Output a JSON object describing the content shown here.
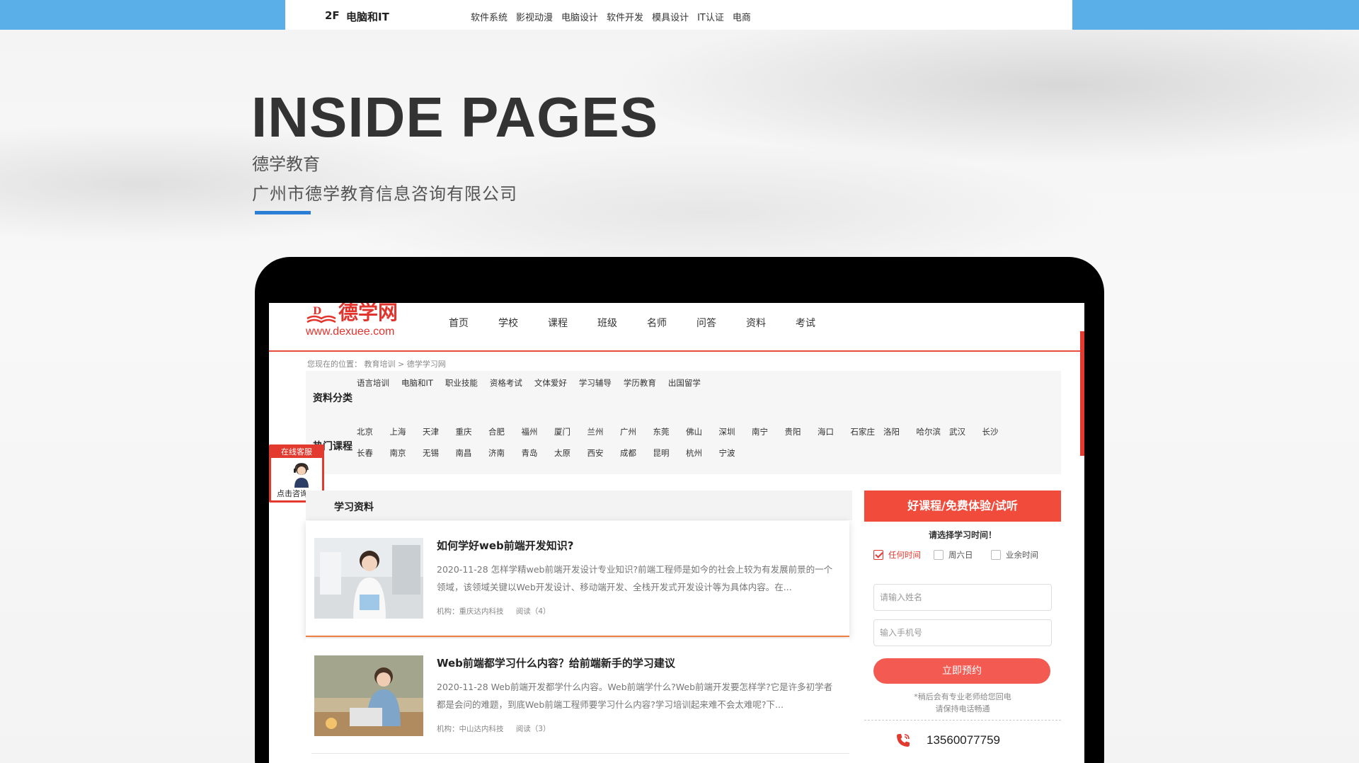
{
  "topbar": {
    "floor_number": "2F",
    "floor_title": "电脑和IT",
    "links": [
      "软件系统",
      "影视动漫",
      "电脑设计",
      "软件开发",
      "模具设计",
      "IT认证",
      "电商"
    ]
  },
  "hero": {
    "title": "INSIDE PAGES",
    "subtitle": "德学教育",
    "company": "广州市德学教育信息咨询有限公司"
  },
  "site": {
    "logo_text": "德学网",
    "logo_url": "www.dexuee.com",
    "nav": [
      "首页",
      "学校",
      "课程",
      "班级",
      "名师",
      "问答",
      "资料",
      "考试"
    ],
    "breadcrumb": "您现在的位置： 教育培训 > 德学学习网"
  },
  "categories": {
    "label": "资料分类",
    "items": [
      "语言培训",
      "电脑和IT",
      "职业技能",
      "资格考试",
      "文体爱好",
      "学习辅导",
      "学历教育",
      "出国留学"
    ]
  },
  "hot_courses": {
    "label": "热门课程",
    "cities_row1": [
      "北京",
      "上海",
      "天津",
      "重庆",
      "合肥",
      "福州",
      "厦门",
      "兰州",
      "广州",
      "东莞",
      "佛山",
      "深圳",
      "南宁",
      "贵阳",
      "海口",
      "石家庄",
      "洛阳",
      "哈尔滨",
      "武汉",
      "长沙"
    ],
    "cities_row2": [
      "长春",
      "南京",
      "无锡",
      "南昌",
      "济南",
      "青岛",
      "太原",
      "西安",
      "成都",
      "昆明",
      "杭州",
      "宁波"
    ]
  },
  "service": {
    "header": "在线客服",
    "button": "点击咨询"
  },
  "materials": {
    "heading": "学习资料",
    "articles": [
      {
        "title": "如何学好web前端开发知识?",
        "desc": "2020-11-28 怎样学精web前端开发设计专业知识?前端工程师是如今的社会上较为有发展前景的一个领域，该领域关键以Web开发设计、移动端开发、全栈开发式开发设计等为具体内容。在...",
        "org": "机构：重庆达内科技",
        "reads": "阅读（4）"
      },
      {
        "title": "Web前端都学习什么内容？给前端新手的学习建议",
        "desc": "2020-11-28 Web前端开发都学什么内容。Web前端学什么?Web前端开发要怎样学?它是许多初学者都是会问的难题，到底Web前端工程师要学习什么内容?学习培训起来难不会太难呢?下...",
        "org": "机构：中山达内科技",
        "reads": "阅读（3）"
      }
    ]
  },
  "booking": {
    "heading": "好课程/免费体验/试听",
    "prompt": "请选择学习时间！",
    "options": [
      "任何时间",
      "周六日",
      "业余时间"
    ],
    "selected_option": "任何时间",
    "name_placeholder": "请输入姓名",
    "phone_placeholder": "输入手机号",
    "submit": "立即预约",
    "note1": "*稍后会有专业老师给您回电",
    "note2": "请保持电话畅通",
    "phone": "13560077759"
  },
  "colors": {
    "topbar_blue": "#5aafe9",
    "brand_red": "#e23a2f",
    "panel_red": "#f04b3b",
    "accent_blue": "#2a7fd4"
  }
}
